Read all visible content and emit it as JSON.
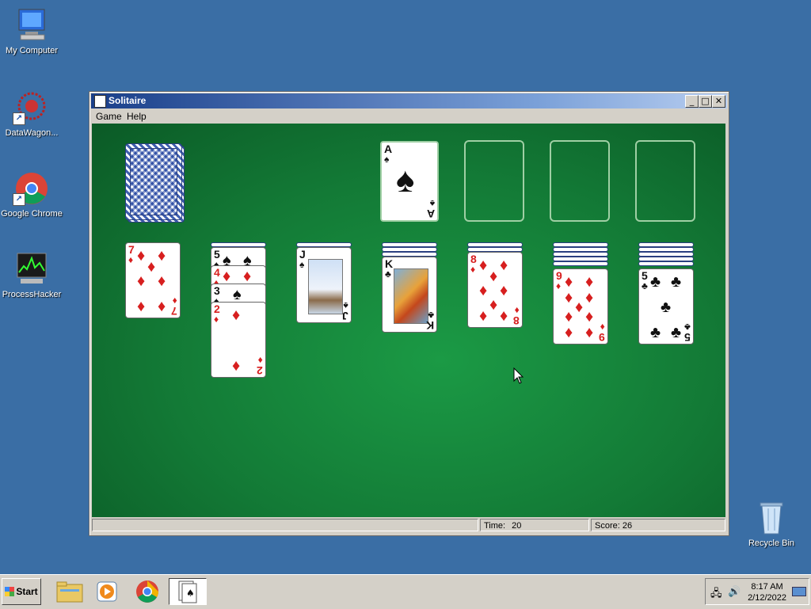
{
  "desktop": {
    "icons": [
      {
        "label": "My Computer"
      },
      {
        "label": "DataWagon..."
      },
      {
        "label": "Google Chrome"
      },
      {
        "label": "ProcessHacker"
      },
      {
        "label": "Recycle Bin"
      }
    ]
  },
  "window": {
    "title": "Solitaire",
    "controls": {
      "minimize": "_",
      "maximize": "□",
      "close": "✕"
    },
    "menu": [
      {
        "label": "Game"
      },
      {
        "label": "Help"
      }
    ],
    "status": {
      "time_label": "Time:",
      "time_value": "20",
      "score_label": "Score:",
      "score_value": "26"
    }
  },
  "game": {
    "suits": {
      "spade": "♠",
      "heart": "♥",
      "diamond": "♦",
      "club": "♣"
    },
    "foundation": [
      {
        "rank": "A",
        "suit": "♠"
      }
    ],
    "tableau": [
      {
        "cards": [
          {
            "rank": "7",
            "suit": "♦"
          }
        ]
      },
      {
        "cards": [
          {
            "rank": "5",
            "suit": "♠"
          },
          {
            "rank": "4",
            "suit": "♦"
          },
          {
            "rank": "3",
            "suit": "♠"
          },
          {
            "rank": "2",
            "suit": "♦"
          }
        ]
      },
      {
        "cards": [
          {
            "rank": "J",
            "suit": "♠"
          }
        ]
      },
      {
        "cards": [
          {
            "rank": "K",
            "suit": "♣"
          }
        ]
      },
      {
        "cards": [
          {
            "rank": "8",
            "suit": "♦"
          }
        ]
      },
      {
        "cards": [
          {
            "rank": "9",
            "suit": "♦"
          }
        ]
      },
      {
        "cards": [
          {
            "rank": "5",
            "suit": "♣"
          }
        ]
      }
    ]
  },
  "taskbar": {
    "start_label": "Start",
    "clock_time": "8:17 AM",
    "clock_date": "2/12/2022"
  },
  "colors": {
    "desktop": "#3a6ea5",
    "felt": "#137a36",
    "red_suit": "#d71f1f"
  }
}
